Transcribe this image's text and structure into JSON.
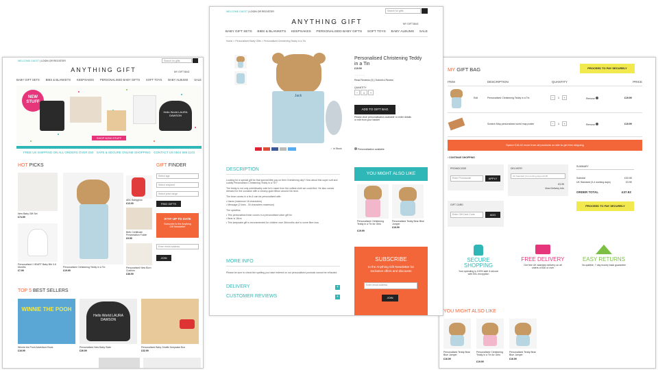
{
  "left": {
    "header": {
      "welcome": "WELCOME GUEST",
      "login": "LOGIN OR REGISTER",
      "search_placeholder": "Search for gifts",
      "gift_bag": "MY GIFT BAG"
    },
    "logo": "ANYTHING GIFT",
    "nav": [
      "BABY GIFT SETS",
      "BIBS & BLANKETS",
      "KEEPSAKES",
      "PERSONALISED BABY GIFTS",
      "SOFT TOYS",
      "BABY ALBUMS",
      "SALE"
    ],
    "hero": {
      "badge_line1": "NEW",
      "badge_line2": "STUFF",
      "cta": "SHOP NOW STUFF",
      "slate_text": "Hello World LAURA DAWSON"
    },
    "usp": [
      "FREE UK SHIPPING ON ALL ORDERS OVER £50",
      "SAFE & SECURE ONLINE SHOPPING",
      "CONTACT US 0844 589 1103"
    ],
    "hot_picks": {
      "title_a": "HOT",
      "title_b": "PICKS",
      "items": [
        {
          "label": "New Baby Gift Set",
          "price": "£74.99"
        },
        {
          "label": "Personalised I HEART Baby Bib 0-6 Months",
          "price": "£7.99"
        },
        {
          "label": "Personalised Christening Teddy in a Tin",
          "price": "£19.99"
        },
        {
          "label": "ABC Babygrow",
          "price": "£12.00"
        },
        {
          "label": "Birth Certificate Presentation Folder",
          "price": "£9.99"
        },
        {
          "label": "Personalised New Born Cushion",
          "price": "£36.99"
        }
      ]
    },
    "gift_finder": {
      "title_a": "GIFT",
      "title_b": "FINDER",
      "selects": [
        "Select age",
        "Select recipient",
        "Select price range"
      ],
      "button": "FIND GIFTS"
    },
    "newsletter": {
      "title": "STAY UP TO DATE",
      "text": "Subscribe to the Anything Gift Newsletter",
      "placeholder": "Enter email address",
      "button": "JOIN"
    },
    "best_sellers": {
      "title_a": "TOP 5",
      "title_b": "BEST SELLERS",
      "items": [
        {
          "label": "Winnie the Pooh Adventure Book",
          "price": "£16.99",
          "art": "WINNIE THE POOH"
        },
        {
          "label": "Personalised New Baby Slate",
          "price": "£26.99",
          "art": "Hello World LAURA DAWSON"
        },
        {
          "label": "Personalised Baby Giraffe Keepsake Box",
          "price": "£32.99",
          "art": ""
        },
        {
          "label": "",
          "price": "",
          "art": ""
        }
      ]
    }
  },
  "center": {
    "header": {
      "welcome": "WELCOME GUEST",
      "login": "LOGIN OR REGISTER",
      "search_placeholder": "Search for gifts",
      "gift_bag": "MY GIFT BAG"
    },
    "logo": "ANYTHING GIFT",
    "nav": [
      "BABY GIFT SETS",
      "BIBS & BLANKETS",
      "KEEPSAKES",
      "PERSONALISED BABY GIFTS",
      "SOFT TOYS",
      "BABY ALBUMS",
      "SALE"
    ],
    "breadcrumb": "Home > Personalised Baby Gifts > Personalised Christening Teddy in a Tin",
    "product": {
      "title": "Personalised Christening Teddy in a Tin",
      "price": "£19.99",
      "reviews": "Read Reviews (0) | Submit a Review",
      "quantity_label": "QUANTITY",
      "quantity": "1",
      "add_button": "ADD TO GIFT BAG",
      "note": "Please click 'personalisation available' to enter details or edit from your basket",
      "in_stock": "In Stock",
      "personalisation": "Personalisation available",
      "tin_text": "Jack"
    },
    "description": {
      "title": "DESCRIPTION",
      "paras": [
        "Looking for a special gift for that special little guy on their Christening day? How about this super soft and cuddly Personalised Christening Teddy in a Tin?",
        "The teddy is not only unbelievably cute he's made from the softest cloth we could find. He also comes dressed for the occasion with a creamy-gold ribbon around his neck.",
        "The bear comes in a tin & can be personalised with:",
        "Name (maximum 16 characters)",
        "Message (2 lines - 30 characters maximum)",
        "The specifics:",
        "This personalised bear comes in a personalised silver gift tin",
        "Bear is 18cm",
        "This keepsake gift is recommended for children over 36months due to come fibre loss"
      ]
    },
    "more_info": {
      "title": "MORE INFO",
      "text": "Please be sure to check the spelling you have entered on our personalised products cannot be refunded."
    },
    "accordions": [
      "DELIVERY",
      "CUSTOMER REVIEWS"
    ],
    "also_like": {
      "title": "YOU MIGHT ALSO LIKE",
      "items": [
        {
          "label": "Personalised Christening Teddy in a Tin for Girls",
          "price": "£19.99"
        },
        {
          "label": "Personalised Teddy Bear Blue Jumper",
          "price": "£16.99"
        }
      ]
    },
    "subscribe": {
      "title": "SUBSCRIBE",
      "text": "to the Anything Gift Newsletter for exclusive offers and discounts",
      "placeholder": "Enter email address",
      "button": "JOIN"
    }
  },
  "right": {
    "title_a": "MY",
    "title_b": "GIFT BAG",
    "proceed": "PROCEED TO PAY SECURELY",
    "columns": [
      "ITEM",
      "DESCRIPTION",
      "QUANTITY",
      "PRICE"
    ],
    "rows": [
      {
        "edit": "Edit",
        "desc": "Personalised Christening Teddy in a Tin",
        "qty": "1",
        "remove": "Remove",
        "price": "£19.99"
      },
      {
        "edit": "",
        "desc": "Scratch Map personalised world map poster",
        "qty": "1",
        "remove": "Remove",
        "price": "£19.99"
      }
    ],
    "banner": "Spend £16.42 more from all products on site to get free shipping",
    "continue": "CONTINUE SHOPPING",
    "promo": {
      "title": "PROMOCODE",
      "placeholder": "Enter Promocode",
      "button": "APPLY"
    },
    "delivery": {
      "title": "DELIVERY",
      "option": "UK Standard (3-4 working days) £3.95",
      "price": "£3.95",
      "info": "View Delivery Info"
    },
    "giftcard": {
      "title": "GIFT CARD",
      "placeholder": "Enter Gift Card Code",
      "button": "ADD"
    },
    "summary": {
      "title": "SUMMARY",
      "subtotal_label": "Subtotal",
      "subtotal": "£33.98",
      "delivery_label": "UK Standard (3-4 working days)",
      "delivery": "£3.95",
      "total_label": "ORDER TOTAL",
      "total": "£37.93",
      "button": "PROCEED TO PAY SECURELY"
    },
    "features": [
      {
        "title": "SECURE SHOPPING",
        "text": "Your spending is 100% safe & secure with SSL encryption",
        "color": "#2fb7b7"
      },
      {
        "title": "FREE DELIVERY",
        "text": "Get free UK standard delivery on all orders of £50 or over",
        "color": "#e6357a"
      },
      {
        "title": "EASY RETURNS",
        "text": "No quibble, 7 day money back guarantee",
        "color": "#7bc043"
      }
    ],
    "also_like": {
      "title": "YOU MIGHT ALSO LIKE",
      "items": [
        {
          "label": "Personalised Teddy Bear Blue Jumper",
          "price": "£16.99"
        },
        {
          "label": "Personalised Christening Teddy in a Tin for Girls",
          "price": "£19.99"
        },
        {
          "label": "Personalised Teddy Bear Blue Jumper",
          "price": "£16.99"
        }
      ]
    }
  }
}
